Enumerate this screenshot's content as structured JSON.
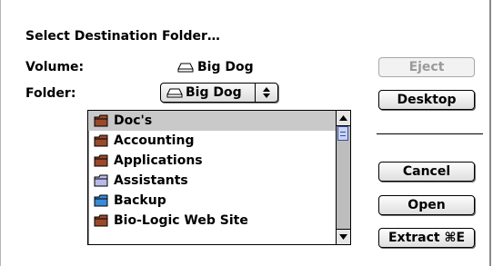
{
  "dialog": {
    "title": "Select Destination Folder…",
    "volume_label": "Volume:",
    "volume_value": "Big Dog",
    "folder_label": "Folder:",
    "folder_popup_value": "Big Dog",
    "popup_arrows": "▲▼"
  },
  "file_list": {
    "items": [
      {
        "label": "Doc's",
        "icon": "folder-brown-icon",
        "selected": true
      },
      {
        "label": "Accounting",
        "icon": "folder-brown-icon",
        "selected": false
      },
      {
        "label": "Applications",
        "icon": "folder-brown-icon",
        "selected": false
      },
      {
        "label": "Assistants",
        "icon": "folder-lavender-icon",
        "selected": false
      },
      {
        "label": "Backup",
        "icon": "folder-blue-icon",
        "selected": false
      },
      {
        "label": "Bio-Logic Web Site",
        "icon": "folder-brown-icon",
        "selected": false
      }
    ]
  },
  "buttons": {
    "eject": "Eject",
    "desktop": "Desktop",
    "cancel": "Cancel",
    "open": "Open",
    "extract": "Extract ⌘E"
  },
  "colors": {
    "folder_brown": "#9a4a2a",
    "folder_lavender": "#b9b9e8",
    "folder_blue": "#3a8ad8",
    "selection": "#c9c9c9"
  }
}
